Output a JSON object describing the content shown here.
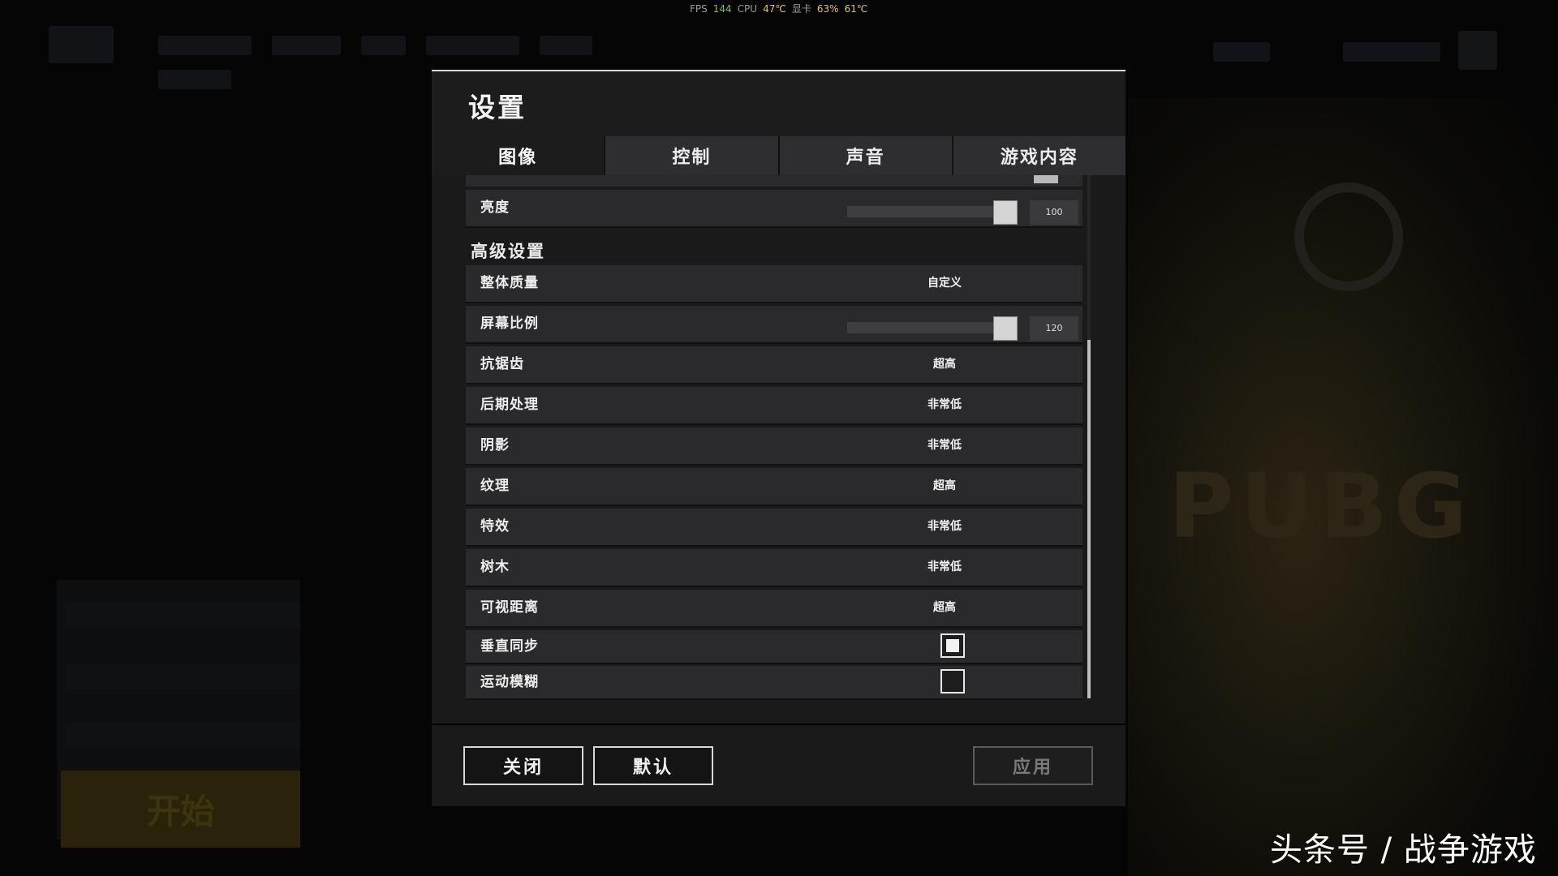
{
  "overlay": {
    "fps_label": "FPS",
    "fps_value": "144",
    "cpu_label": "CPU",
    "cpu_temp": "47℃",
    "gpu_label": "显卡",
    "gpu_usage": "63%",
    "gpu_temp": "61℃"
  },
  "background": {
    "start_button": "开始",
    "logo_text": "PUBG"
  },
  "dialog": {
    "title": "设置",
    "tabs": [
      {
        "label": "图像",
        "active": true
      },
      {
        "label": "控制",
        "active": false
      },
      {
        "label": "声音",
        "active": false
      },
      {
        "label": "游戏内容",
        "active": false
      }
    ],
    "brightness": {
      "label": "亮度",
      "value": "100"
    },
    "advanced_title": "高级设置",
    "overall_quality": {
      "label": "整体质量",
      "value": "自定义"
    },
    "screen_scale": {
      "label": "屏幕比例",
      "value": "120"
    },
    "settings": [
      {
        "label": "抗锯齿",
        "value": "超高"
      },
      {
        "label": "后期处理",
        "value": "非常低"
      },
      {
        "label": "阴影",
        "value": "非常低"
      },
      {
        "label": "纹理",
        "value": "超高"
      },
      {
        "label": "特效",
        "value": "非常低"
      },
      {
        "label": "树木",
        "value": "非常低"
      },
      {
        "label": "可视距离",
        "value": "超高"
      }
    ],
    "vsync": {
      "label": "垂直同步",
      "checked": true
    },
    "motion_blur": {
      "label": "运动模糊",
      "checked": false
    },
    "buttons": {
      "close": "关闭",
      "default": "默认",
      "apply": "应用"
    }
  },
  "watermark": "头条号 / 战争游戏"
}
